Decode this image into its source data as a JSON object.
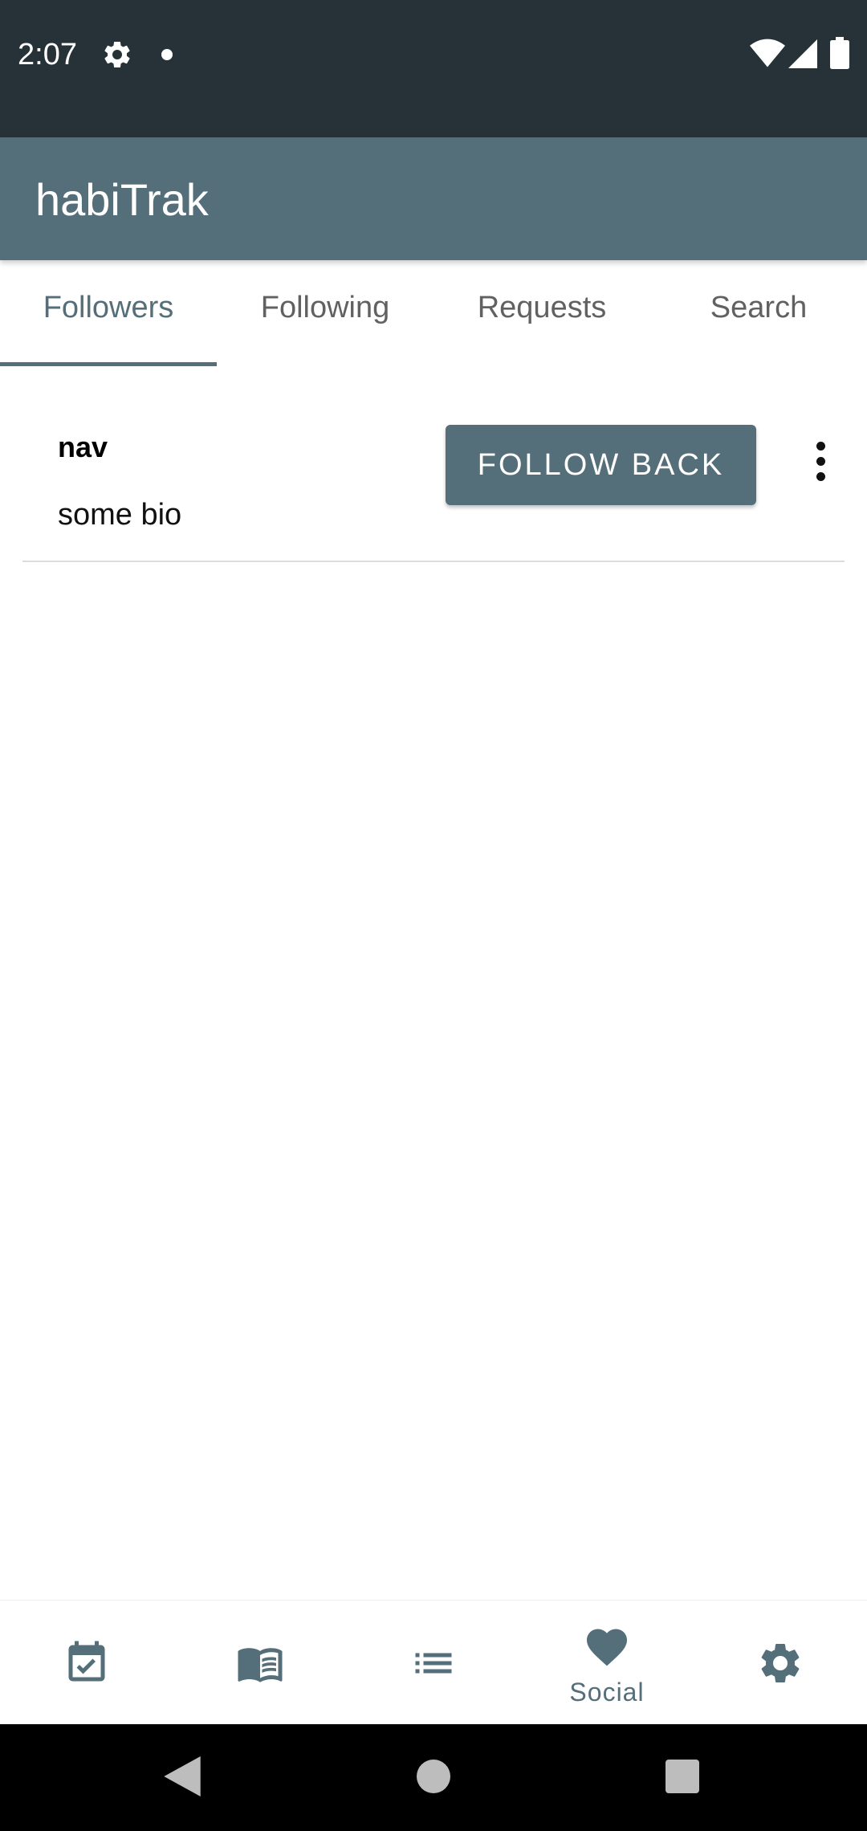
{
  "status_bar": {
    "time": "2:07",
    "icons": [
      "gear-icon",
      "notification-dot-icon",
      "wifi-icon",
      "signal-icon",
      "battery-icon"
    ]
  },
  "app_bar": {
    "title": "habiTrak"
  },
  "tabs": [
    {
      "label": "Followers",
      "active": true
    },
    {
      "label": "Following",
      "active": false
    },
    {
      "label": "Requests",
      "active": false
    },
    {
      "label": "Search",
      "active": false
    }
  ],
  "followers": [
    {
      "name": "nav",
      "bio": "some bio",
      "action_label": "FOLLOW BACK"
    }
  ],
  "bottom_nav": {
    "items": [
      {
        "icon": "calendar-check-icon",
        "label": "",
        "active": false
      },
      {
        "icon": "open-book-icon",
        "label": "",
        "active": false
      },
      {
        "icon": "list-icon",
        "label": "",
        "active": false
      },
      {
        "icon": "heart-icon",
        "label": "Social",
        "active": true
      },
      {
        "icon": "settings-gear-icon",
        "label": "",
        "active": false
      }
    ]
  },
  "colors": {
    "status_bar": "#263238",
    "primary": "#546e7a",
    "active_tab": "#546e7a",
    "inactive_tab": "#616161"
  }
}
